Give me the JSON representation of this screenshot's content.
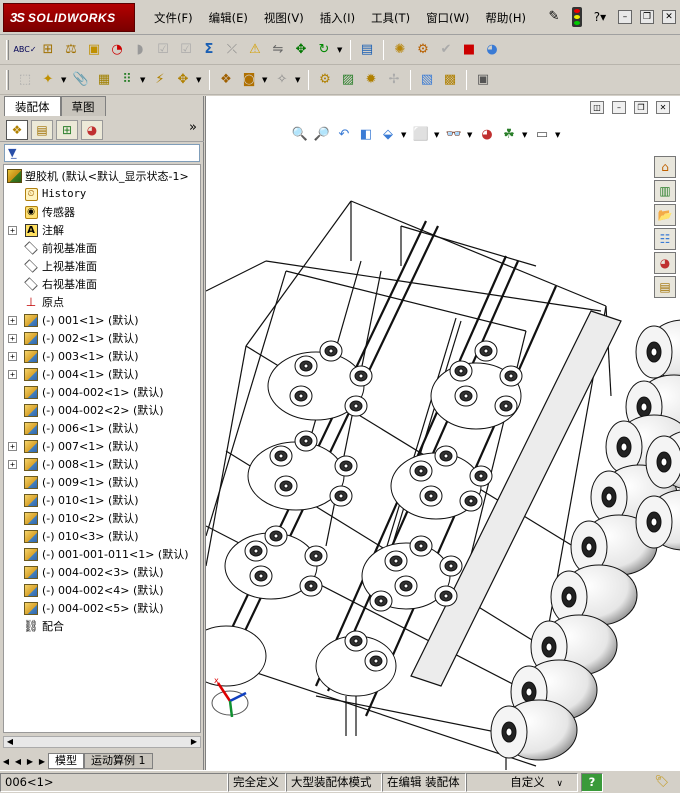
{
  "app": {
    "logo_ds": "3S",
    "logo_name": "SOLIDWORKS"
  },
  "menu": [
    {
      "label": "文件(F)",
      "name": "menu-file"
    },
    {
      "label": "编辑(E)",
      "name": "menu-edit"
    },
    {
      "label": "视图(V)",
      "name": "menu-view"
    },
    {
      "label": "插入(I)",
      "name": "menu-insert"
    },
    {
      "label": "工具(T)",
      "name": "menu-tools"
    },
    {
      "label": "窗口(W)",
      "name": "menu-window"
    },
    {
      "label": "帮助(H)",
      "name": "menu-help"
    }
  ],
  "panel_tabs": {
    "assembly": "装配体",
    "sketch": "草图"
  },
  "tree": {
    "root": "塑胶机  (默认<默认_显示状态-1>",
    "history": "History",
    "sensors": "传感器",
    "annotations": "注解",
    "front_plane": "前视基准面",
    "top_plane": "上视基准面",
    "right_plane": "右视基准面",
    "origin": "原点",
    "components": [
      {
        "label": "(-) 001<1> (默认)",
        "expandable": true
      },
      {
        "label": "(-) 002<1> (默认)",
        "expandable": true
      },
      {
        "label": "(-) 003<1> (默认)",
        "expandable": true
      },
      {
        "label": "(-) 004<1> (默认)",
        "expandable": true
      },
      {
        "label": "(-) 004-002<1> (默认)",
        "expandable": false
      },
      {
        "label": "(-) 004-002<2> (默认)",
        "expandable": false
      },
      {
        "label": "(-) 006<1> (默认)",
        "expandable": false
      },
      {
        "label": "(-) 007<1> (默认)",
        "expandable": true
      },
      {
        "label": "(-) 008<1> (默认)",
        "expandable": true
      },
      {
        "label": "(-) 009<1> (默认)",
        "expandable": false
      },
      {
        "label": "(-) 010<1> (默认)",
        "expandable": false
      },
      {
        "label": "(-) 010<2> (默认)",
        "expandable": false
      },
      {
        "label": "(-) 010<3> (默认)",
        "expandable": false
      },
      {
        "label": "(-) 001-001-011<1> (默认)",
        "expandable": false
      },
      {
        "label": "(-) 004-002<3> (默认)",
        "expandable": false
      },
      {
        "label": "(-) 004-002<4> (默认)",
        "expandable": false
      },
      {
        "label": "(-) 004-002<5> (默认)",
        "expandable": false
      }
    ],
    "mates": "配合"
  },
  "bottom_tabs": {
    "model": "模型",
    "motion": "运动算例 1"
  },
  "status": {
    "selection": "006<1>",
    "definition": "完全定义",
    "mode": "大型装配体模式",
    "editing": "在编辑 装配体",
    "custom": "自定义",
    "custom_arrow": "∨",
    "help": "?"
  },
  "colors": {
    "logo_red": "#b30000",
    "selection_blue": "#2a4fa8"
  },
  "icons": {
    "filter": "filter-icon",
    "panel_more": "»"
  }
}
